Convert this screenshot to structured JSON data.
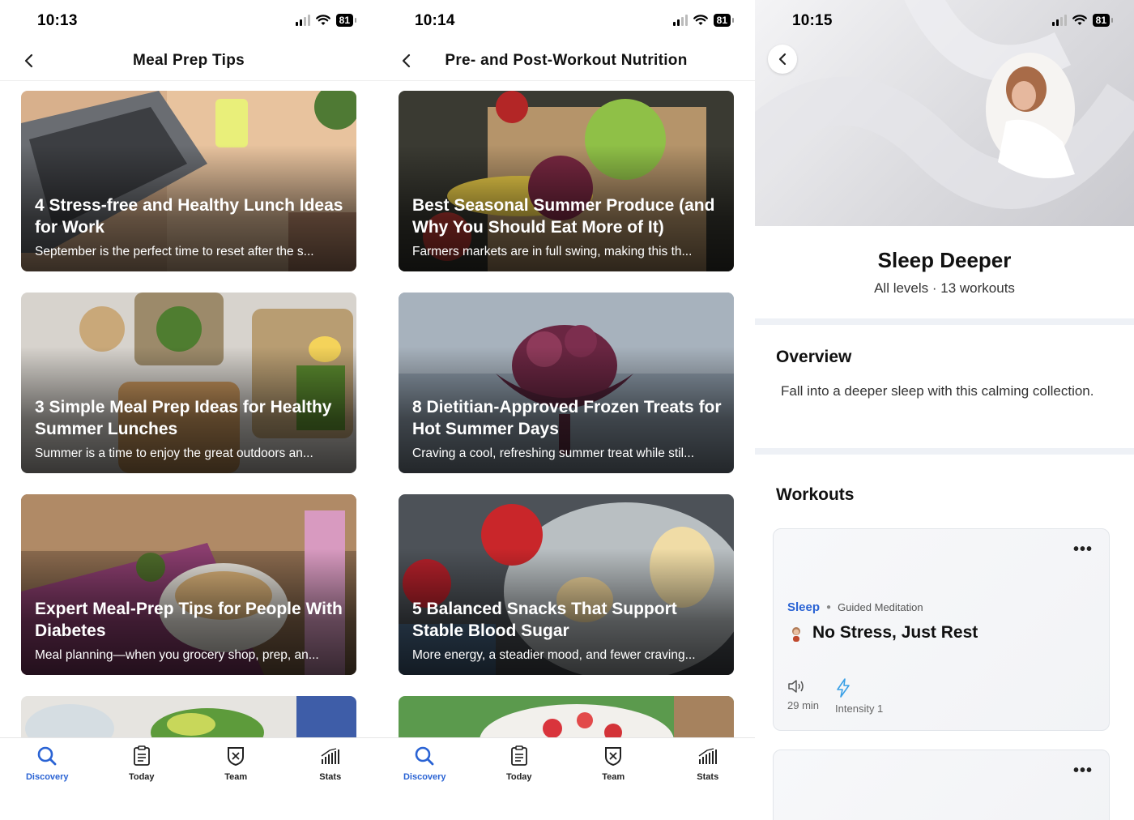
{
  "screens": [
    {
      "status": {
        "time": "10:13",
        "battery": "81"
      },
      "nav": {
        "title": "Meal Prep Tips"
      },
      "cards": [
        {
          "title": "4 Stress-free and Healthy Lunch Ideas for Work",
          "desc": "September is the perfect time to reset after the s..."
        },
        {
          "title": "3 Simple Meal Prep Ideas for Healthy Summer Lunches",
          "desc": "Summer is a time to enjoy the great outdoors an..."
        },
        {
          "title": "Expert Meal-Prep Tips for People With Diabetes",
          "desc": "Meal planning—when you grocery shop, prep, an..."
        }
      ],
      "tabs": [
        {
          "label": "Discovery",
          "icon": "search-icon",
          "active": true
        },
        {
          "label": "Today",
          "icon": "clipboard-icon"
        },
        {
          "label": "Team",
          "icon": "shield-icon"
        },
        {
          "label": "Stats",
          "icon": "stats-icon"
        }
      ]
    },
    {
      "status": {
        "time": "10:14",
        "battery": "81"
      },
      "nav": {
        "title": "Pre- and Post-Workout Nutrition"
      },
      "cards": [
        {
          "title": "Best Seasonal Summer Produce (and Why You Should Eat More of It)",
          "desc": "Farmers markets are in full swing, making this th..."
        },
        {
          "title": "8 Dietitian-Approved Frozen Treats for Hot Summer Days",
          "desc": "Craving a cool, refreshing summer treat while stil..."
        },
        {
          "title": "5 Balanced Snacks That Support Stable Blood Sugar",
          "desc": "More energy, a steadier mood, and fewer craving..."
        }
      ],
      "tabs": [
        {
          "label": "Discovery",
          "icon": "search-icon",
          "active": true
        },
        {
          "label": "Today",
          "icon": "clipboard-icon"
        },
        {
          "label": "Team",
          "icon": "shield-icon"
        },
        {
          "label": "Stats",
          "icon": "stats-icon"
        }
      ]
    },
    {
      "status": {
        "time": "10:15",
        "battery": "81"
      },
      "program": {
        "title": "Sleep Deeper",
        "subtitle": "All levels · 13 workouts",
        "overview_heading": "Overview",
        "overview_text": "Fall into a deeper sleep with this calming collection.",
        "workouts_heading": "Workouts"
      },
      "workout": {
        "category": "Sleep",
        "type": "Guided Meditation",
        "name": "No Stress, Just Rest",
        "duration": "29 min",
        "intensity": "Intensity 1",
        "more": "•••"
      },
      "workout2": {
        "more": "•••"
      }
    }
  ],
  "colors": {
    "accent": "#2a63d4",
    "bolt": "#3aa0e6"
  }
}
